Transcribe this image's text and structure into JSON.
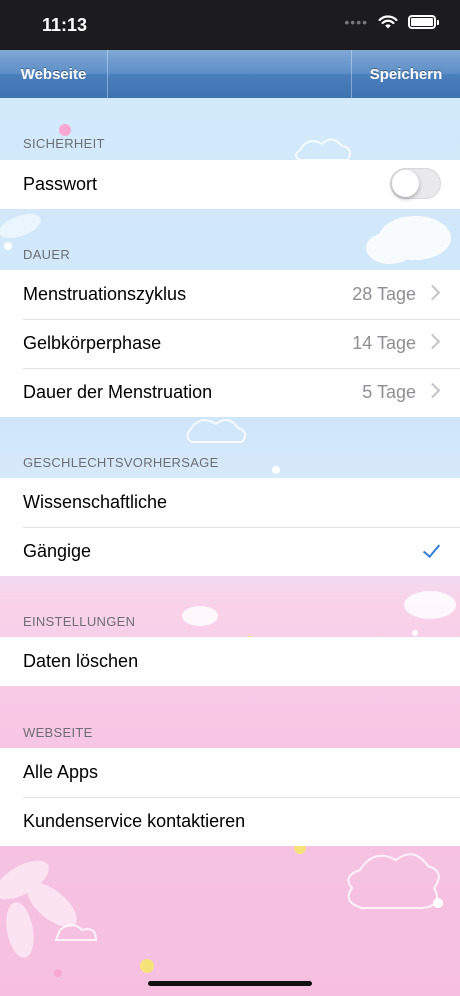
{
  "status_bar": {
    "time": "11:13",
    "signal_icon": "signal-dots-icon",
    "wifi_icon": "wifi-icon",
    "battery_icon": "battery-icon"
  },
  "nav": {
    "left_button": "Webseite",
    "right_button": "Speichern"
  },
  "sections": {
    "security": {
      "header": "SICHERHEIT",
      "password_label": "Passwort",
      "password_on": false
    },
    "duration": {
      "header": "DAUER",
      "rows": [
        {
          "label": "Menstruationszyklus",
          "value": "28 Tage"
        },
        {
          "label": "Gelbkörperphase",
          "value": "14 Tage"
        },
        {
          "label": "Dauer der Menstruation",
          "value": "5 Tage"
        }
      ]
    },
    "gender": {
      "header": "GESCHLECHTSVORHERSAGE",
      "rows": [
        {
          "label": "Wissenschaftliche",
          "selected": false
        },
        {
          "label": "Gängige",
          "selected": true
        }
      ]
    },
    "settings": {
      "header": "EINSTELLUNGEN",
      "rows": [
        {
          "label": "Daten löschen"
        }
      ]
    },
    "website": {
      "header": "WEBSEITE",
      "rows": [
        {
          "label": "Alle Apps"
        },
        {
          "label": "Kundenservice kontaktieren"
        }
      ]
    }
  },
  "colors": {
    "nav_bar": "#4a7fbd",
    "checkmark": "#2f7fd8",
    "background_top": "#cfe6fa",
    "background_bottom": "#f6bfe0"
  }
}
